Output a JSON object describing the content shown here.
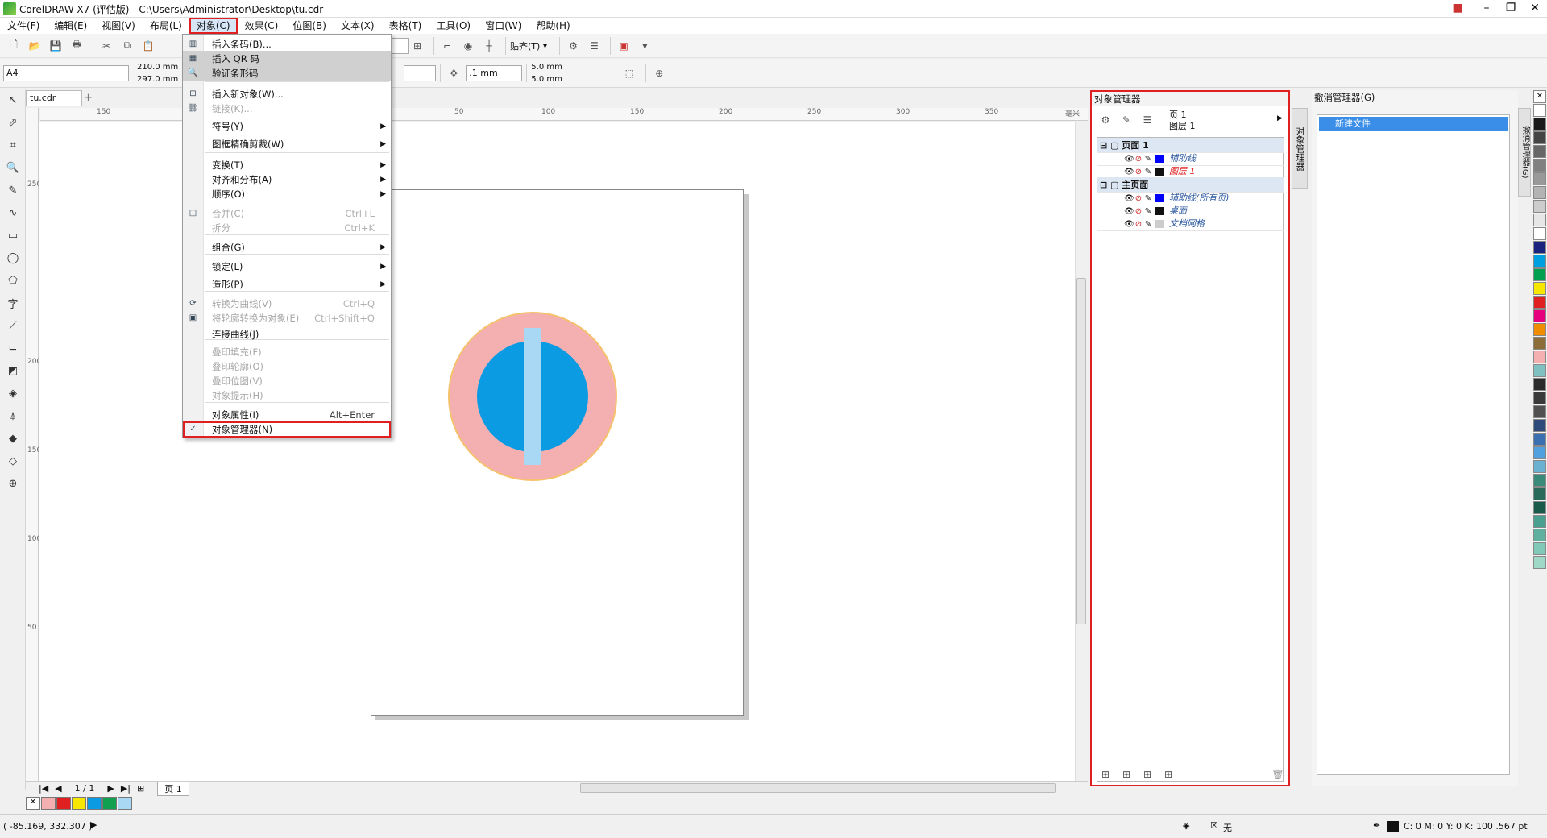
{
  "titlebar": {
    "title": "CorelDRAW X7 (评估版) - C:\\Users\\Administrator\\Desktop\\tu.cdr"
  },
  "menubar": [
    "文件(F)",
    "编辑(E)",
    "视图(V)",
    "布局(L)",
    "对象(C)",
    "效果(C)",
    "位图(B)",
    "文本(X)",
    "表格(T)",
    "工具(O)",
    "窗口(W)",
    "帮助(H)"
  ],
  "toolbar": {
    "snap_label": "贴齐(T)",
    "page_size": "A4",
    "width": "210.0 mm",
    "height": "297.0 mm",
    "nudge": ".1 mm",
    "dup_x": "5.0 mm",
    "dup_y": "5.0 mm"
  },
  "document": {
    "tab": "tu.cdr",
    "page_counter": "1 / 1",
    "page_tab": "页 1",
    "ruler_h": [
      "150",
      "50",
      "100",
      "150",
      "200",
      "250",
      "300",
      "350",
      "毫米"
    ],
    "ruler_v": [
      "250",
      "200",
      "150",
      "100",
      "50"
    ]
  },
  "menu": {
    "items": [
      {
        "label": "插入条码(B)...",
        "shortcut": "",
        "icon": "barcode-icon",
        "disabled": false,
        "submenu": false,
        "highlight": false
      },
      {
        "label": "插入 QR 码",
        "shortcut": "",
        "icon": "qr-code-icon",
        "disabled": false,
        "submenu": false,
        "highlight": true
      },
      {
        "label": "验证条形码",
        "shortcut": "",
        "icon": "verify-barcode-icon",
        "disabled": false,
        "submenu": false,
        "highlight": true
      },
      {
        "label": "插入新对象(W)...",
        "shortcut": "",
        "icon": "insert-object-icon",
        "disabled": false,
        "submenu": false,
        "highlight": false
      },
      {
        "label": "链接(K)...",
        "shortcut": "",
        "icon": "link-icon",
        "disabled": true,
        "submenu": false,
        "highlight": false
      },
      {
        "label": "符号(Y)",
        "shortcut": "",
        "icon": "",
        "disabled": false,
        "submenu": true,
        "highlight": false
      },
      {
        "label": "图框精确剪裁(W)",
        "shortcut": "",
        "icon": "",
        "disabled": false,
        "submenu": true,
        "highlight": false
      },
      {
        "label": "变换(T)",
        "shortcut": "",
        "icon": "",
        "disabled": false,
        "submenu": true,
        "highlight": false
      },
      {
        "label": "对齐和分布(A)",
        "shortcut": "",
        "icon": "",
        "disabled": false,
        "submenu": true,
        "highlight": false
      },
      {
        "label": "顺序(O)",
        "shortcut": "",
        "icon": "",
        "disabled": false,
        "submenu": true,
        "highlight": false
      },
      {
        "label": "合并(C)",
        "shortcut": "Ctrl+L",
        "icon": "combine-icon",
        "disabled": true,
        "submenu": false,
        "highlight": false
      },
      {
        "label": "拆分",
        "shortcut": "Ctrl+K",
        "icon": "",
        "disabled": true,
        "submenu": false,
        "highlight": false
      },
      {
        "label": "组合(G)",
        "shortcut": "",
        "icon": "",
        "disabled": false,
        "submenu": true,
        "highlight": false
      },
      {
        "label": "锁定(L)",
        "shortcut": "",
        "icon": "",
        "disabled": false,
        "submenu": true,
        "highlight": false
      },
      {
        "label": "造形(P)",
        "shortcut": "",
        "icon": "",
        "disabled": false,
        "submenu": true,
        "highlight": false
      },
      {
        "label": "转换为曲线(V)",
        "shortcut": "Ctrl+Q",
        "icon": "convert-curves-icon",
        "disabled": true,
        "submenu": false,
        "highlight": false
      },
      {
        "label": "将轮廓转换为对象(E)",
        "shortcut": "Ctrl+Shift+Q",
        "icon": "outline-to-object-icon",
        "disabled": true,
        "submenu": false,
        "highlight": false
      },
      {
        "label": "连接曲线(J)",
        "shortcut": "",
        "icon": "",
        "disabled": false,
        "submenu": false,
        "highlight": false
      },
      {
        "label": "叠印填充(F)",
        "shortcut": "",
        "icon": "",
        "disabled": true,
        "submenu": false,
        "highlight": false
      },
      {
        "label": "叠印轮廓(O)",
        "shortcut": "",
        "icon": "",
        "disabled": true,
        "submenu": false,
        "highlight": false
      },
      {
        "label": "叠印位图(V)",
        "shortcut": "",
        "icon": "",
        "disabled": true,
        "submenu": false,
        "highlight": false
      },
      {
        "label": "对象提示(H)",
        "shortcut": "",
        "icon": "",
        "disabled": true,
        "submenu": false,
        "highlight": false
      },
      {
        "label": "对象属性(I)",
        "shortcut": "Alt+Enter",
        "icon": "",
        "disabled": false,
        "submenu": false,
        "highlight": false
      },
      {
        "label": "对象管理器(N)",
        "shortcut": "",
        "icon": "check-icon",
        "disabled": false,
        "submenu": false,
        "highlight": false
      }
    ],
    "check_glyph": "✓"
  },
  "object_manager": {
    "title": "对象管理器",
    "page_label": "页 1",
    "layer_label": "图层 1",
    "tree": [
      {
        "type": "section",
        "label": "页面 1"
      },
      {
        "type": "layer",
        "label": "辅助线",
        "color": "#0000ff",
        "text_color": "#2c5aa0"
      },
      {
        "type": "layer",
        "label": "图层 1",
        "color": "#111111",
        "text_color": "#e02020"
      },
      {
        "type": "section",
        "label": "主页面"
      },
      {
        "type": "layer",
        "label": "辅助线(所有页)",
        "color": "#0000ff",
        "text_color": "#2c5aa0"
      },
      {
        "type": "layer",
        "label": "桌面",
        "color": "#111111",
        "text_color": "#2c5aa0"
      },
      {
        "type": "layer",
        "label": "文档网格",
        "color": "#cccccc",
        "text_color": "#2c5aa0"
      }
    ]
  },
  "side_tabs": {
    "object_manager": "对象管理器",
    "undo_manager": "撤消管理器(G)"
  },
  "undo_manager": {
    "title": "撤消管理器(G)",
    "item": "新建文件"
  },
  "artwork": {
    "outer_color": "#f4b0b0",
    "outer_stroke": "#f5c26b",
    "inner_color": "#0b9be3",
    "bar_color": "#a8d8f4"
  },
  "doc_palette": [
    "#f4b0b0",
    "#e02020",
    "#f7e600",
    "#0b9be3",
    "#10a050",
    "#a8d8f4"
  ],
  "palette": [
    "#ffffff",
    "#1a1a1a",
    "#444444",
    "#666666",
    "#808080",
    "#999999",
    "#b3b3b3",
    "#cccccc",
    "#e6e6e6",
    "#ffffff",
    "#1a237e",
    "#00a0e0",
    "#00a050",
    "#f7e600",
    "#e02020",
    "#e6007e",
    "#f08c00",
    "#8c6d3a",
    "#f4b0b0",
    "#80c0c0",
    "#2a2a2a",
    "#3a3a3a",
    "#505050",
    "#2d4a7a",
    "#3a6fb0",
    "#50a0e0",
    "#6ab0d0",
    "#3a8a7a",
    "#2a6a5a",
    "#1a5a4a",
    "#4aa090",
    "#60b0a0",
    "#80c8b8",
    "#a0d8c8"
  ],
  "status": {
    "coords": "( -85.169, 332.307 )",
    "fill_none": "无",
    "color_info": "C: 0 M: 0 Y: 0 K: 100  .567 pt"
  }
}
